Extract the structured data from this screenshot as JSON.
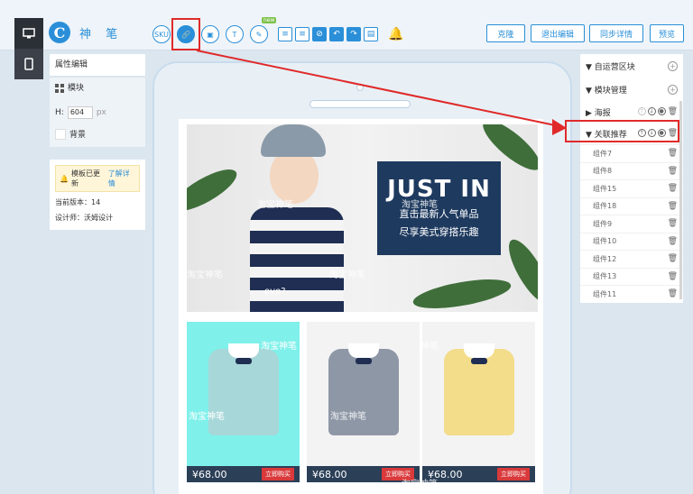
{
  "app": {
    "logo_glyph": "C",
    "name": "神 笔"
  },
  "left_rail": [
    {
      "icon": "desktop-icon"
    },
    {
      "icon": "mobile-icon"
    }
  ],
  "toolbar": {
    "tools": [
      {
        "label": "SKU",
        "icon": "sku-icon"
      },
      {
        "label": "🔗",
        "icon": "link-icon"
      },
      {
        "label": "▣",
        "icon": "image-icon"
      },
      {
        "label": "T",
        "icon": "text-icon"
      },
      {
        "label": "✎",
        "icon": "pen-icon"
      }
    ],
    "new_badge": "new",
    "edit_tools": [
      {
        "label": "≡",
        "icon": "align-top-icon"
      },
      {
        "label": "≡",
        "icon": "align-bottom-icon"
      },
      {
        "label": "⊘",
        "icon": "link-break-icon"
      },
      {
        "label": "↶",
        "icon": "undo-icon"
      },
      {
        "label": "↷",
        "icon": "redo-icon"
      },
      {
        "label": "▤",
        "icon": "save-icon"
      }
    ],
    "bell_glyph": "🔔",
    "buttons": {
      "clone": "克隆",
      "exit_edit": "退出编辑",
      "sync_details": "同步详情",
      "preview": "预览"
    }
  },
  "left_panel": {
    "tab_properties": "属性编辑",
    "tab_module": "模块",
    "height_label": "H:",
    "height_value": "604",
    "height_unit": "px",
    "background_label": "背景",
    "notice": {
      "text": "模板已更新",
      "link": "了解详情",
      "version_label": "当前版本：14",
      "designer_label": "设计师：沃姆设计"
    }
  },
  "canvas": {
    "banner": {
      "title": "JUST IN",
      "line1": "直击最新人气单品",
      "line2": "尽享美式穿搭乐趣",
      "tshirt_text": "ove?"
    },
    "watermarks": {
      "w1": "淘宝神笔",
      "w2": "淘宝神笔",
      "w3": "淘宝神笔",
      "w4": "淘宝神笔",
      "w5": "淘宝神笔",
      "w6": "淘宝神笔",
      "w7": "淘宝神笔",
      "w8": "淘宝神笔",
      "w9": "淘宝神笔"
    },
    "products": [
      {
        "price": "¥68.00",
        "buy": "立即购买",
        "color": "#a7d7d8"
      },
      {
        "price": "¥68.00",
        "buy": "立即购买",
        "color": "#8e97a6"
      },
      {
        "price": "¥68.00",
        "buy": "立即购买",
        "color": "#f3dc8a"
      }
    ]
  },
  "right_panel": {
    "self_run": "自运营区块",
    "module_manage": "模块管理",
    "poster": "海报",
    "related": "关联推荐",
    "components": [
      "组件7",
      "组件8",
      "组件15",
      "组件18",
      "组件9",
      "组件10",
      "组件12",
      "组件13",
      "组件11"
    ]
  },
  "colors": {
    "accent": "#2a8fd8",
    "highlight": "#e02a2a",
    "selected_product": "#7ff0ea"
  }
}
